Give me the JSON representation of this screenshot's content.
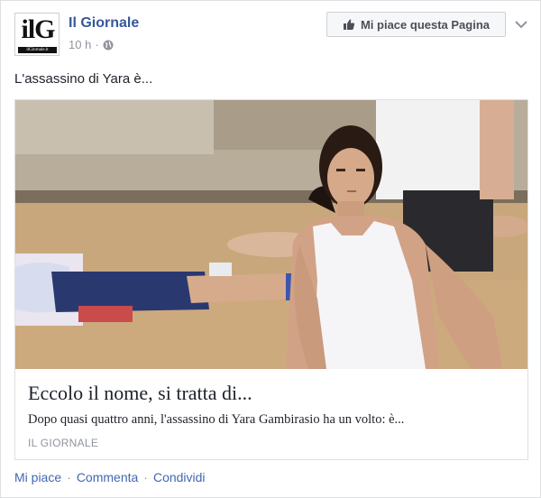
{
  "post": {
    "page_name": "Il Giornale",
    "logo_text": "ilG",
    "logo_subtext": "ilGiornale.it",
    "time": "10 h",
    "dot": "·",
    "privacy_icon": "globe-icon",
    "like_page_label": "Mi piace questa Pagina",
    "like_page_icon": "thumbs-up-icon",
    "menu_icon": "chevron-down-icon",
    "text": "L'assassino di Yara è..."
  },
  "link": {
    "title": "Eccolo il nome, si tratta di...",
    "description": "Dopo quasi quattro anni, l'assassino di Yara Gambirasio ha un volto: è...",
    "source": "IL GIORNALE"
  },
  "actions": {
    "like": "Mi piace",
    "comment": "Commenta",
    "share": "Condividi",
    "separator": "·"
  },
  "colors": {
    "page_link": "#365899",
    "action_link": "#4267b2",
    "meta_text": "#90949c",
    "card_border": "#dddfe2"
  }
}
